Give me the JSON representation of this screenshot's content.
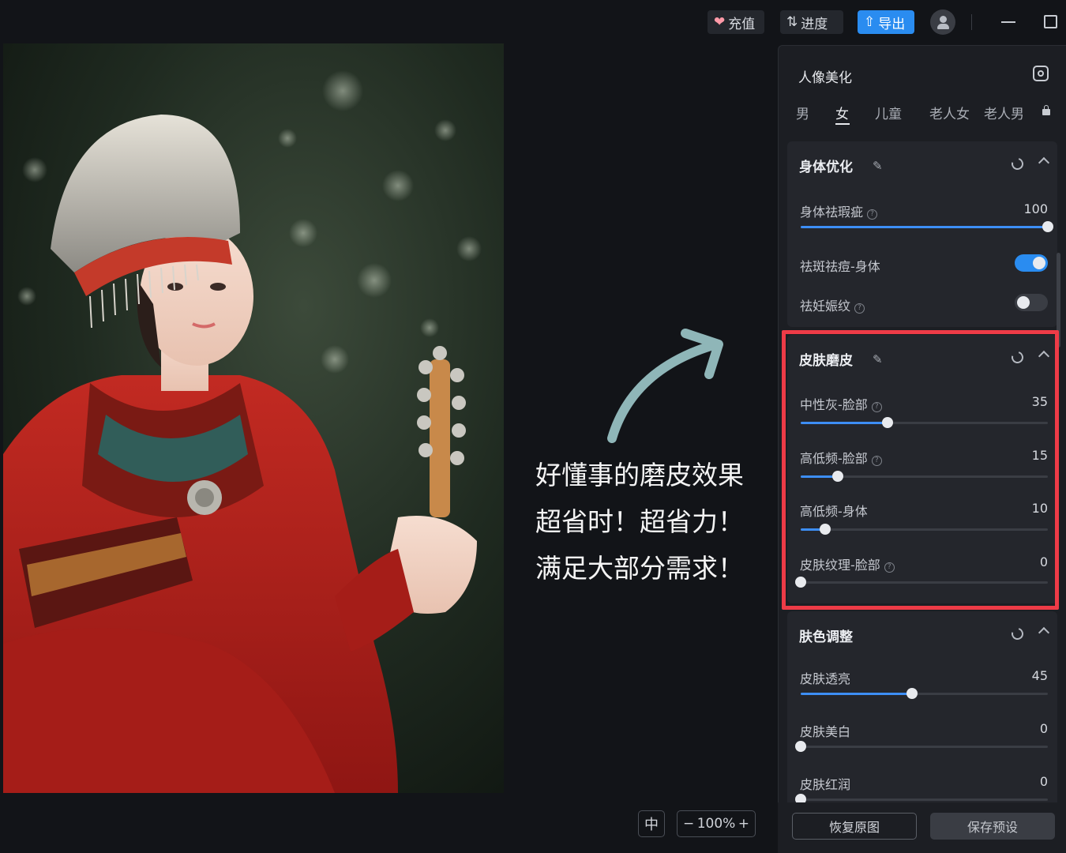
{
  "topbar": {
    "recharge_label": "充值",
    "progress_label": "进度",
    "export_label": "导出"
  },
  "panel": {
    "title": "人像美化",
    "gender_tabs": [
      "男",
      "女",
      "儿童",
      "老人女",
      "老人男"
    ],
    "active_tab": "女",
    "sections": {
      "body": {
        "title": "身体优化",
        "rows": [
          {
            "label": "身体祛瑕疵",
            "value": "100",
            "level": 100
          },
          {
            "label": "祛斑祛痘-身体",
            "toggle": true
          },
          {
            "label": "祛妊娠纹",
            "toggle": false
          }
        ]
      },
      "skin_smooth": {
        "title": "皮肤磨皮",
        "rows": [
          {
            "label": "中性灰-脸部",
            "value": "35",
            "level": 35
          },
          {
            "label": "高低频-脸部",
            "value": "15",
            "level": 15
          },
          {
            "label": "高低频-身体",
            "value": "10",
            "level": 10
          },
          {
            "label": "皮肤纹理-脸部",
            "value": "0",
            "level": 0
          }
        ]
      },
      "skin_tone": {
        "title": "肤色调整",
        "rows": [
          {
            "label": "皮肤透亮",
            "value": "45",
            "level": 45
          },
          {
            "label": "皮肤美白",
            "value": "0",
            "level": 0
          },
          {
            "label": "皮肤红润",
            "value": "0",
            "level": 0
          }
        ]
      }
    },
    "footer": {
      "restore_label": "恢复原图",
      "save_label": "保存预设"
    }
  },
  "annotation": {
    "lines": [
      "好懂事的磨皮效果",
      "超省时！超省力！",
      "满足大部分需求！"
    ]
  },
  "zoom": {
    "fit_icon": "中",
    "minus": "−",
    "value": "100%",
    "plus": "+"
  },
  "colors": {
    "accent": "#2a8cf0",
    "highlight": "#ee3b47",
    "arrow": "#8fb6b8"
  }
}
